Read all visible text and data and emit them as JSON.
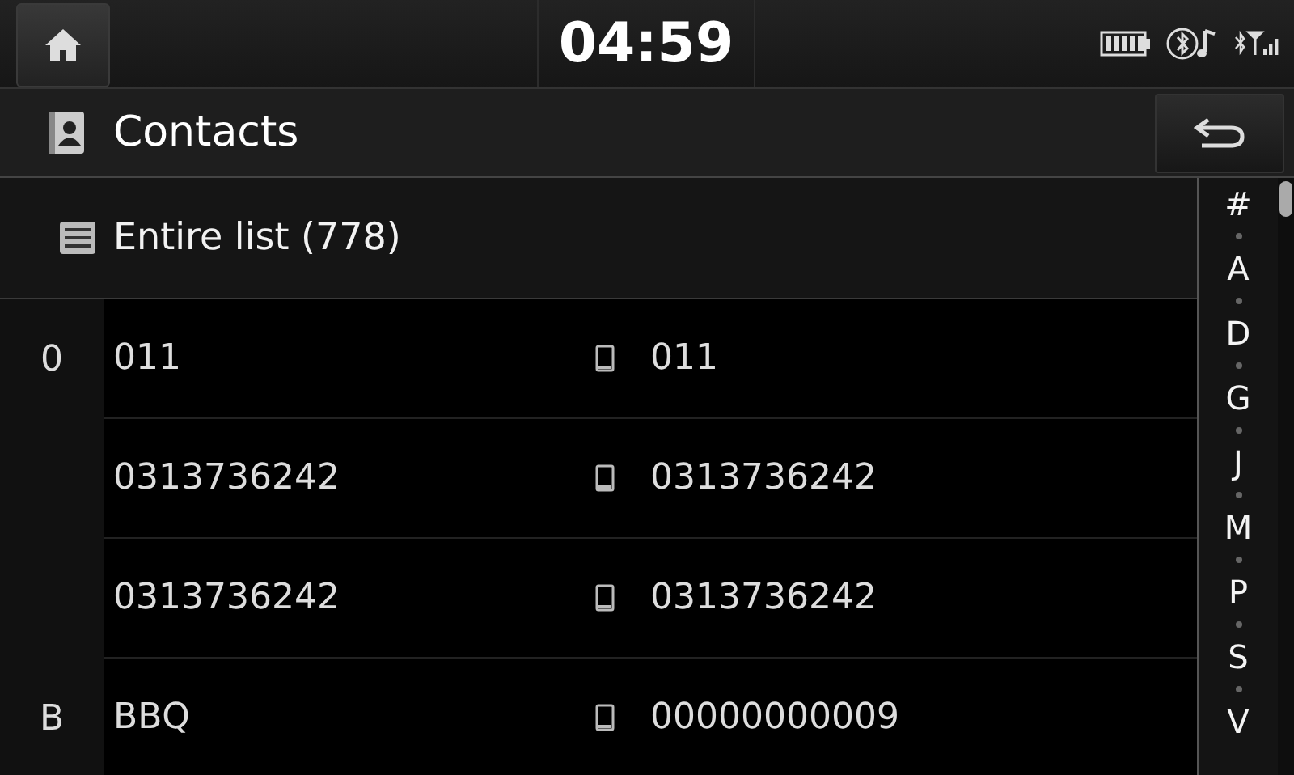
{
  "status_bar": {
    "time": "04:59"
  },
  "header": {
    "title": "Contacts"
  },
  "list_header": {
    "label": "Entire list (778)"
  },
  "contacts": [
    {
      "group": "0",
      "name": "011",
      "number": "011"
    },
    {
      "name": "0313736242",
      "number": "0313736242"
    },
    {
      "name": "0313736242",
      "number": "0313736242"
    },
    {
      "group": "B",
      "name": "BBQ",
      "number": "00000000009"
    }
  ],
  "index": [
    "#",
    "A",
    "D",
    "G",
    "J",
    "M",
    "P",
    "S",
    "V"
  ]
}
